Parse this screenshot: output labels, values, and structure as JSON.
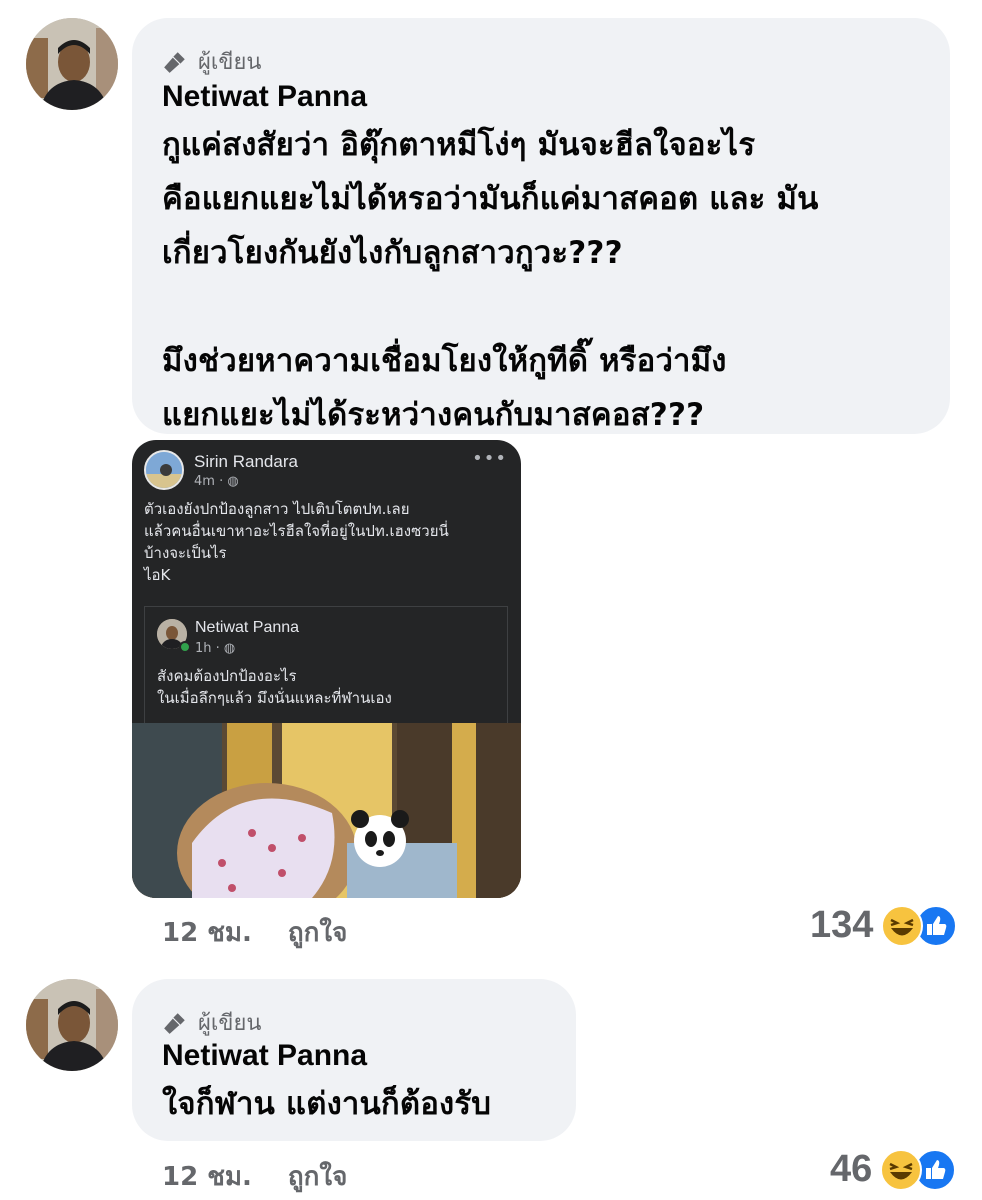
{
  "comments": [
    {
      "author_badge": "ผู้เขียน",
      "name": "Netiwat Panna",
      "text": "กูแค่สงสัยว่า อิตุ๊กตาหมีโง่ๆ มันจะฮีลใจอะไร\nคือแยกแยะไม่ได้หรอว่ามันก็แค่มาสคอต และ มัน\nเกี่ยวโยงกันยังไงกับลูกสาวกูวะ???\n\nมึงช่วยหาความเชื่อมโยงให้กูทีดิ๊ หรือว่ามึง\nแยกแยะไม่ได้ระหว่างคนกับมาสคอส???",
      "time": "12 ชม.",
      "like_label": "ถูกใจ",
      "reaction_count": "134",
      "reaction_icons": [
        "haha-icon",
        "like-icon"
      ]
    },
    {
      "author_badge": "ผู้เขียน",
      "name": "Netiwat Panna",
      "text": "ใจก็ฬาน แต่งานก็ต้องรับ",
      "time": "12 ชม.",
      "like_label": "ถูกใจ",
      "reaction_count": "46",
      "reaction_icons": [
        "haha-icon",
        "like-icon"
      ]
    }
  ],
  "embedded_post": {
    "name": "Sirin Randara",
    "time": "4m · ",
    "more": "•••",
    "text": "ตัวเองยังปกป้องลูกสาว ไปเติบโตตปท.เลย\nแล้วคนอื่นเขาหาอะไรฮีลใจที่อยู่ในปท.เฮงซวยนี่\nบ้างจะเป็นไร\nไอK",
    "quoted": {
      "name": "Netiwat Panna",
      "time": "1h · ",
      "text": "สังคมต้องปกป้องอะไร\nในเมื่อลึกๆแล้ว มึงนั่นแหละที่ฬานเอง"
    }
  },
  "colors": {
    "bubble": "#f0f2f5",
    "secondary_text": "#65676b",
    "like_blue": "#1877f2",
    "haha_yellow": "#f7c33f",
    "embed_bg": "#242526"
  }
}
